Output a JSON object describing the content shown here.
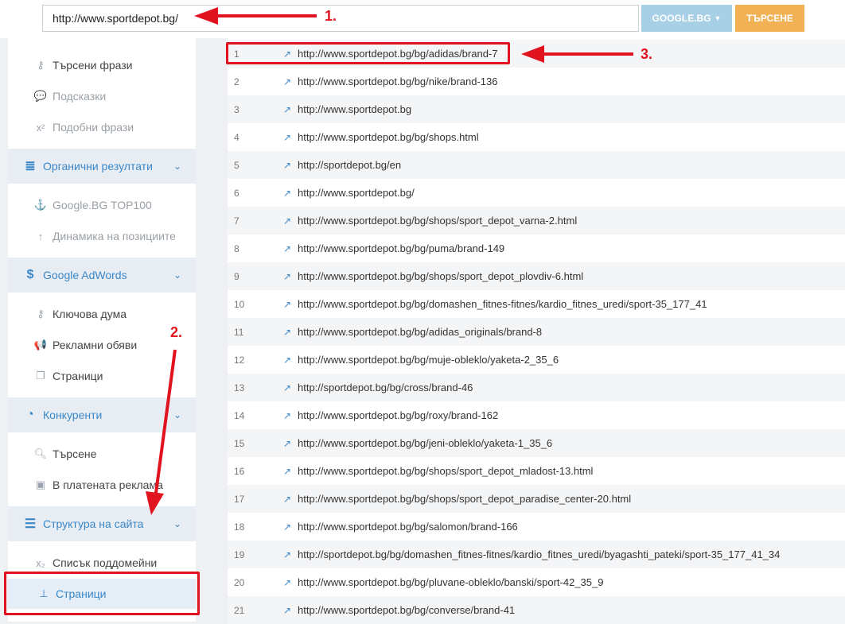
{
  "toolbar": {
    "url_value": "http://www.sportdepot.bg/",
    "engine_label": "GOOGLE.BG",
    "search_label": "ТЪРСЕНЕ"
  },
  "sidebar": {
    "items": [
      {
        "label": "Търсени фрази",
        "icon": "key-icon"
      },
      {
        "label": "Подсказки",
        "icon": "speech-bubble-icon"
      },
      {
        "label": "Подобни фрази",
        "icon": "superscript-icon"
      }
    ],
    "organic": {
      "label": "Органични резултати",
      "icon": "database-icon"
    },
    "organic_items": [
      {
        "label": "Google.BG TOP100",
        "icon": "anchor-icon"
      },
      {
        "label": "Динамика на позициите",
        "icon": "arrow-up-icon"
      }
    ],
    "adwords": {
      "label": "Google AdWords",
      "icon": "dollar-icon"
    },
    "adwords_items": [
      {
        "label": "Ключова дума",
        "icon": "key-icon"
      },
      {
        "label": "Рекламни обяви",
        "icon": "megaphone-icon"
      },
      {
        "label": "Страници",
        "icon": "copy-icon"
      }
    ],
    "competitors": {
      "label": "Конкуренти",
      "icon": "pie-chart-icon"
    },
    "competitors_items": [
      {
        "label": "Търсене",
        "icon": "search-icon"
      },
      {
        "label": "В платената реклама",
        "icon": "money-icon"
      }
    ],
    "structure": {
      "label": "Структура на сайта",
      "icon": "list-icon"
    },
    "structure_items": [
      {
        "label": "Списък поддомейни",
        "icon": "subscript-icon"
      },
      {
        "label": "Страници",
        "icon": "sitemap-icon"
      }
    ]
  },
  "annotations": {
    "one": "1.",
    "two": "2.",
    "three": "3."
  },
  "results": [
    {
      "n": "1",
      "url": "http://www.sportdepot.bg/bg/adidas/brand-7"
    },
    {
      "n": "2",
      "url": "http://www.sportdepot.bg/bg/nike/brand-136"
    },
    {
      "n": "3",
      "url": "http://www.sportdepot.bg"
    },
    {
      "n": "4",
      "url": "http://www.sportdepot.bg/bg/shops.html"
    },
    {
      "n": "5",
      "url": "http://sportdepot.bg/en"
    },
    {
      "n": "6",
      "url": "http://www.sportdepot.bg/"
    },
    {
      "n": "7",
      "url": "http://www.sportdepot.bg/bg/shops/sport_depot_varna-2.html"
    },
    {
      "n": "8",
      "url": "http://www.sportdepot.bg/bg/puma/brand-149"
    },
    {
      "n": "9",
      "url": "http://www.sportdepot.bg/bg/shops/sport_depot_plovdiv-6.html"
    },
    {
      "n": "10",
      "url": "http://www.sportdepot.bg/bg/domashen_fitnes-fitnes/kardio_fitnes_uredi/sport-35_177_41"
    },
    {
      "n": "11",
      "url": "http://www.sportdepot.bg/bg/adidas_originals/brand-8"
    },
    {
      "n": "12",
      "url": "http://www.sportdepot.bg/bg/muje-obleklo/yaketa-2_35_6"
    },
    {
      "n": "13",
      "url": "http://sportdepot.bg/bg/cross/brand-46"
    },
    {
      "n": "14",
      "url": "http://www.sportdepot.bg/bg/roxy/brand-162"
    },
    {
      "n": "15",
      "url": "http://www.sportdepot.bg/bg/jeni-obleklo/yaketa-1_35_6"
    },
    {
      "n": "16",
      "url": "http://www.sportdepot.bg/bg/shops/sport_depot_mladost-13.html"
    },
    {
      "n": "17",
      "url": "http://www.sportdepot.bg/bg/shops/sport_depot_paradise_center-20.html"
    },
    {
      "n": "18",
      "url": "http://www.sportdepot.bg/bg/salomon/brand-166"
    },
    {
      "n": "19",
      "url": "http://sportdepot.bg/bg/domashen_fitnes-fitnes/kardio_fitnes_uredi/byagashti_pateki/sport-35_177_41_34"
    },
    {
      "n": "20",
      "url": "http://www.sportdepot.bg/bg/pluvane-obleklo/banski/sport-42_35_9"
    },
    {
      "n": "21",
      "url": "http://www.sportdepot.bg/bg/converse/brand-41"
    }
  ],
  "colors": {
    "accent": "#3a87c8",
    "annotation": "#e0131e",
    "search": "#f2b155",
    "engine": "#a7cfe6"
  }
}
